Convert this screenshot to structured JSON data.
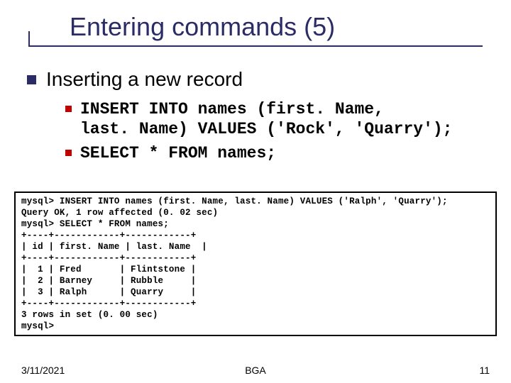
{
  "title": "Entering commands (5)",
  "main_bullet": "Inserting a new record",
  "sub_bullets": [
    "INSERT INTO names (first. Name,\nlast. Name) VALUES ('Rock', 'Quarry');",
    "SELECT * FROM names;"
  ],
  "console": "mysql> INSERT INTO names (first. Name, last. Name) VALUES ('Ralph', 'Quarry');\nQuery OK, 1 row affected (0. 02 sec)\nmysql> SELECT * FROM names;\n+----+------------+------------+\n| id | first. Name | last. Name  |\n+----+------------+------------+\n|  1 | Fred       | Flintstone |\n|  2 | Barney     | Rubble     |\n|  3 | Ralph      | Quarry     |\n+----+------------+------------+\n3 rows in set (0. 00 sec)\nmysql>",
  "footer": {
    "date": "3/11/2021",
    "center": "BGA",
    "page": "11"
  }
}
